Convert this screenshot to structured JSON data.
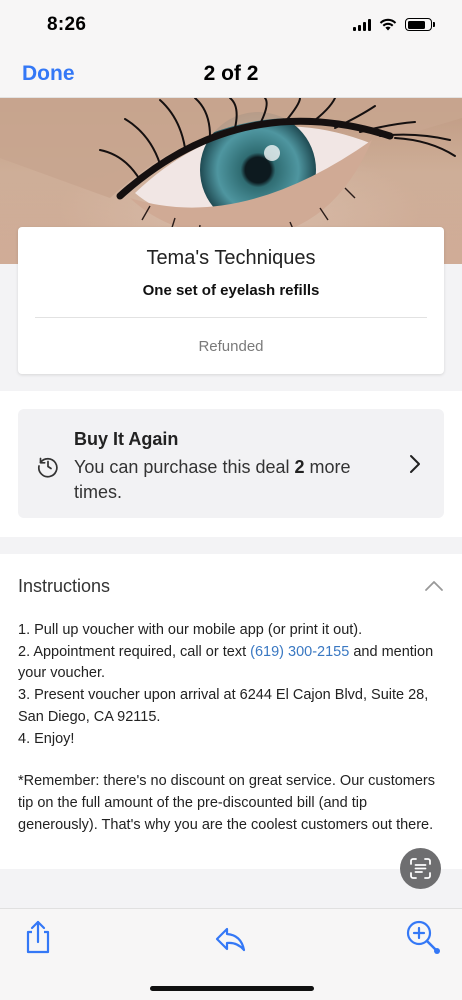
{
  "status_bar": {
    "time": "8:26"
  },
  "nav": {
    "done_label": "Done",
    "page_counter": "2 of 2"
  },
  "hero": {
    "icon": "eye-photo"
  },
  "deal": {
    "merchant": "Tema's Techniques",
    "title": "One set of eyelash refills",
    "status": "Refunded"
  },
  "buy_again": {
    "title": "Buy It Again",
    "desc_prefix": "You can purchase this deal",
    "count": "2",
    "desc_suffix": "more times."
  },
  "instructions": {
    "header": "Instructions",
    "step1": "1. Pull up voucher with our mobile app (or print it out).",
    "step2_prefix": "2. Appointment required, call or text",
    "phone": "(619) 300-2155",
    "step2_suffix": "and mention your voucher.",
    "step3": "3. Present voucher upon arrival at 6244 El Cajon Blvd, Suite 28, San Diego, CA 92115.",
    "step4": "4. Enjoy!",
    "note": "*Remember: there's no discount on great service. Our customers tip on the full amount of the pre-discounted bill (and tip generously). That's why you are the coolest customers out there."
  },
  "colors": {
    "ios_blue": "#3478f6",
    "link": "#3a78c2"
  }
}
